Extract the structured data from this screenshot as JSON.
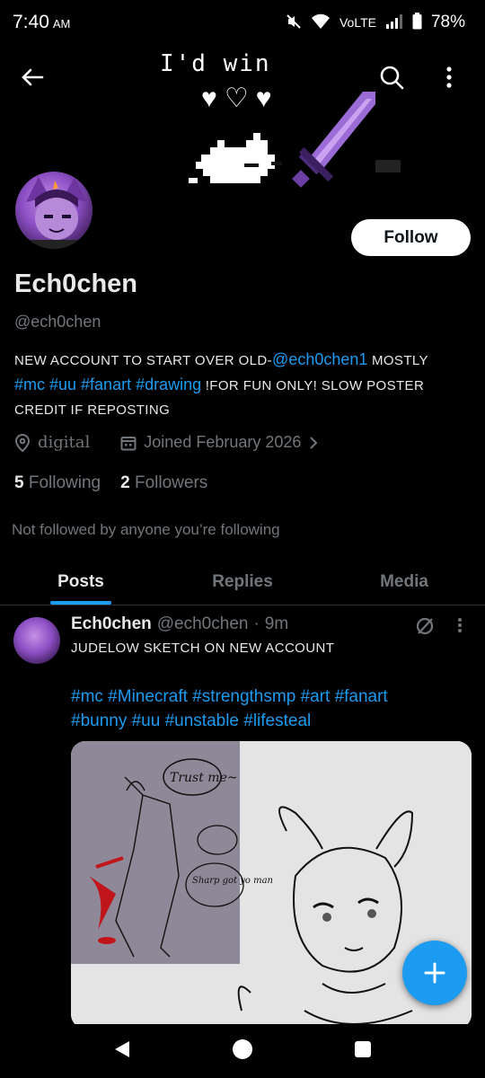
{
  "status_bar": {
    "time": "7:40",
    "ampm": "AM",
    "network": "VoLTE",
    "battery": "78%"
  },
  "banner": {
    "text": "I'd win"
  },
  "profile": {
    "display_name": "Ech0chen",
    "handle": "@ech0chen",
    "follow_label": "Follow",
    "bio_line1_prefix": "NEW ACCOUNT TO START OVER OLD-",
    "bio_mention": "@ech0chen1",
    "bio_line1_suffix": " MOSTLY",
    "bio_tags": "#mc #uu #fanart #drawing",
    "bio_line2_suffix": " !FOR FUN ONLY!  SLOW POSTER",
    "bio_line3": "CREDIT IF REPOSTING",
    "location": "digital",
    "joined": "Joined February 2026",
    "following_count": "5",
    "following_label": "Following",
    "followers_count": "2",
    "followers_label": "Followers",
    "not_followed_note": "Not followed by anyone you’re following"
  },
  "tabs": [
    {
      "label": "Posts"
    },
    {
      "label": "Replies"
    },
    {
      "label": "Media"
    }
  ],
  "post": {
    "author": "Ech0chen",
    "handle": "@ech0chen",
    "separator": "·",
    "time": "9m",
    "text": "JUDELOW SKETCH ON NEW ACCOUNT",
    "tags_line1": "#mc #Minecraft #strengthsmp #art #fanart",
    "tags_line2": "#bunny #uu #unstable #lifesteal",
    "sketch_bubble1": "Trust me~",
    "sketch_bubble2": "Sharp got yo man"
  },
  "colors": {
    "accent": "#1d9bf0",
    "background": "#000000",
    "text_primary": "#e7e9ea",
    "text_secondary": "#71767b"
  }
}
